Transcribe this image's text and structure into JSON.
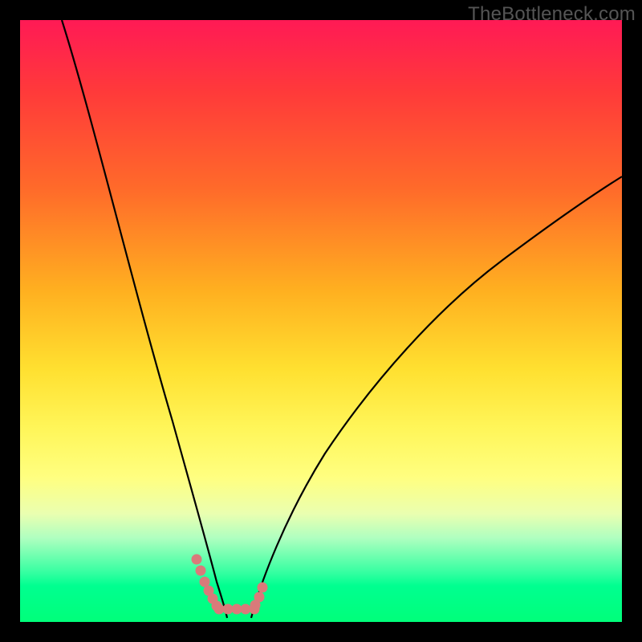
{
  "watermark": "TheBottleneck.com",
  "chart_data": {
    "type": "line",
    "title": "",
    "xlabel": "",
    "ylabel": "",
    "xlim": [
      0,
      100
    ],
    "ylim": [
      0,
      100
    ],
    "grid": false,
    "series": [
      {
        "name": "curve-left",
        "x": [
          7,
          10,
          14,
          18,
          22,
          26,
          28,
          30,
          32,
          33
        ],
        "y": [
          100,
          82,
          62,
          44,
          28,
          15,
          9,
          5,
          2,
          0
        ],
        "color": "#000000"
      },
      {
        "name": "curve-right",
        "x": [
          38,
          40,
          44,
          50,
          58,
          66,
          74,
          82,
          90,
          100
        ],
        "y": [
          0,
          4,
          12,
          24,
          38,
          50,
          59,
          67,
          73,
          78
        ],
        "color": "#000000"
      },
      {
        "name": "marker-left-dots",
        "x": [
          29.3,
          30.0,
          30.7,
          31.3,
          32.0,
          32.7
        ],
        "y": [
          10.5,
          8.5,
          6.7,
          5.2,
          3.8,
          2.6
        ],
        "color": "#d97a7a"
      },
      {
        "name": "marker-bottom-dots",
        "x": [
          33.0,
          34.5,
          36.0,
          37.5,
          39.0
        ],
        "y": [
          2.2,
          2.2,
          2.2,
          2.2,
          2.2
        ],
        "color": "#d97a7a"
      },
      {
        "name": "marker-right-dots",
        "x": [
          39.0,
          39.7,
          40.3
        ],
        "y": [
          2.8,
          4.2,
          5.8
        ],
        "color": "#d97a7a"
      }
    ],
    "background_gradient": {
      "top": "#ff1a55",
      "mid": "#ffe030",
      "bottom": "#00ff7a"
    }
  },
  "colors": {
    "frame": "#000000",
    "curve": "#000000",
    "marker": "#d97a7a",
    "watermark": "#555555"
  }
}
